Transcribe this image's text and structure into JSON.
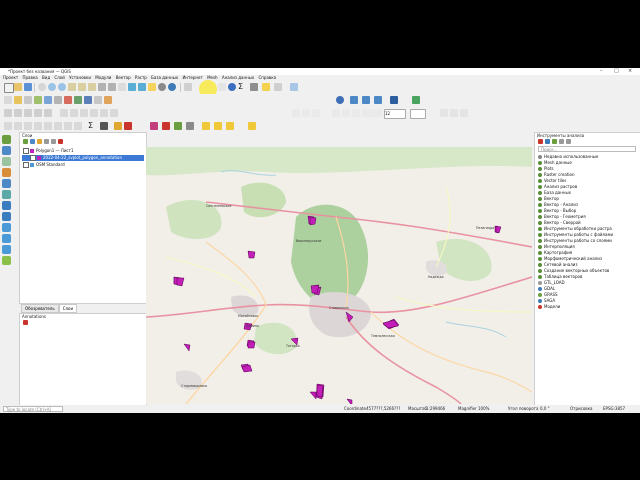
{
  "app": {
    "title": "*Проект без названия — QGIS"
  },
  "menu": [
    "Проект",
    "Правка",
    "Вид",
    "Слой",
    "Установки",
    "Модули",
    "Вектор",
    "Растр",
    "База данных",
    "Интернет",
    "Mesh",
    "Анализ данных",
    "Справка"
  ],
  "layers_panel": {
    "title": "Слои",
    "items": [
      {
        "label": "Polygon1 — Лист1",
        "checked": true,
        "selected": false
      },
      {
        "label": "2022-04-22_svplot_polygon_annotation",
        "checked": true,
        "selected": true
      },
      {
        "label": "OSM Standard",
        "checked": true,
        "selected": false
      }
    ]
  },
  "left_tabs": [
    "Обозреватель",
    "Слои"
  ],
  "annotations_panel": {
    "title": "Annotations"
  },
  "map": {
    "colors": {
      "land": "#f2efe9",
      "forest": "#add19e",
      "urban": "#dddddd",
      "water": "#aad3df",
      "road_major": "#e892a2",
      "road_primary": "#fcd6a4",
      "polygon": "#c21fb8",
      "polygon_stroke": "#5a0052"
    },
    "labels": [
      "Ставрополь",
      "Михайловск",
      "Надежда",
      "Верхнерусское",
      "Темнолесская",
      "Дёмино",
      "Пелагиада",
      "Старомарьевка",
      "Татарка",
      "Сенгилеевское"
    ]
  },
  "processing": {
    "title": "Инструменты анализа",
    "search_placeholder": "Поиск...",
    "items": [
      "Недавно использованные",
      "Mesh данные",
      "Plots",
      "Raster creation",
      "Vector tiles",
      "Анализ растров",
      "База данных",
      "Вектор",
      "Вектор - Анализ",
      "Вектор - Выбор",
      "Вектор - Геометрия",
      "Вектор - Сверрой",
      "Инструменты обработки растра",
      "Инструменты работы с файлами",
      "Инструменты работы со слоями",
      "Интерполяция",
      "Картография",
      "Морфометрический анализ",
      "Сетевой анализ",
      "Создание векторных объектов",
      "Таблица векторов",
      "GTL_LOAD",
      "GDAL",
      "GRASS",
      "SAGA",
      "Модели"
    ]
  },
  "statusbar": {
    "locator_placeholder": "Type to locate (Ctrl+K)",
    "coordinate_label": "Coordinate",
    "coordinate_value": "4577???,5266???",
    "scale_label": "Масштаб",
    "scale_value": "1:299466",
    "magnifier_label": "Magnifier",
    "magnifier_value": "100%",
    "rotation_label": "Угол поворота",
    "rotation_value": "0,0 °",
    "render_label": "Отрисовка",
    "crs": "EPSG:3857"
  },
  "toolbar": {
    "zoom_value": "12"
  }
}
